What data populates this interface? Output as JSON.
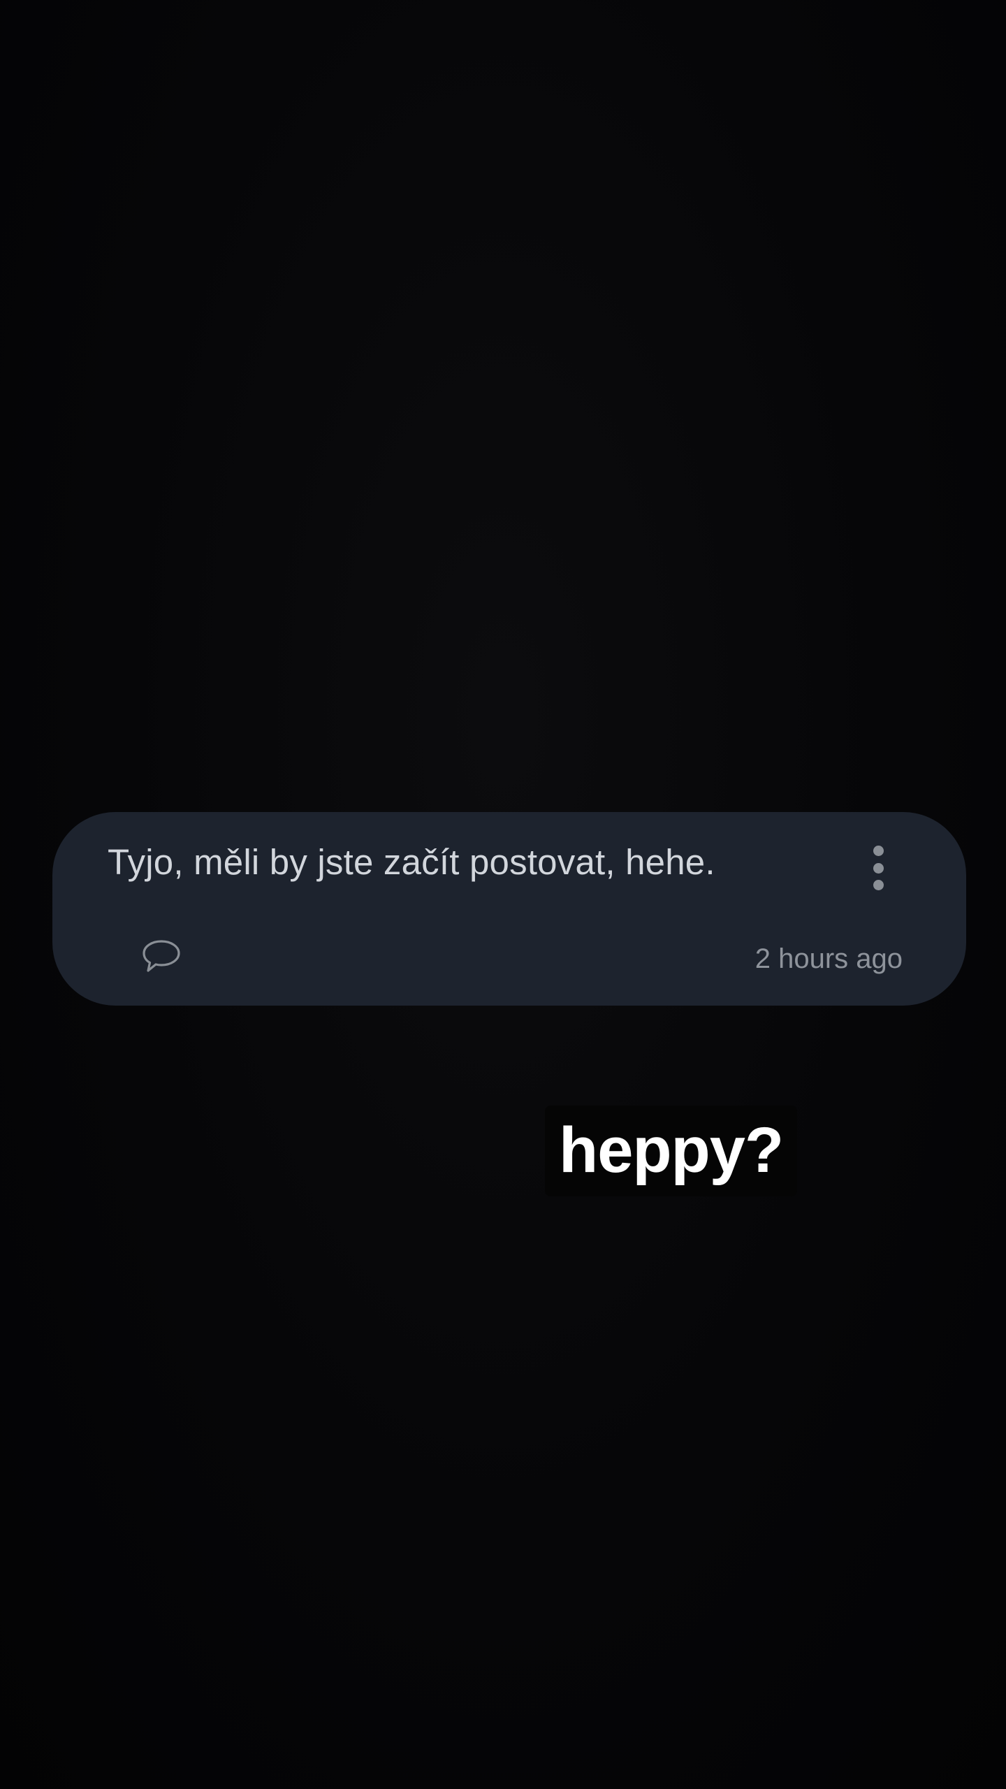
{
  "comment": {
    "text": "Tyjo, měli by jste začít postovat, hehe.",
    "timestamp": "2 hours ago",
    "reply_icon": "speech-bubble-icon",
    "more_icon": "vertical-ellipsis-icon"
  },
  "sticker": {
    "text": "heppy?"
  },
  "colors": {
    "card_background": "#1d232e",
    "comment_text": "#d2d6dc",
    "timestamp_text": "#8e939b",
    "icon": "#8a8f96",
    "sticker_text": "#ffffff",
    "sticker_background": "#050505"
  }
}
